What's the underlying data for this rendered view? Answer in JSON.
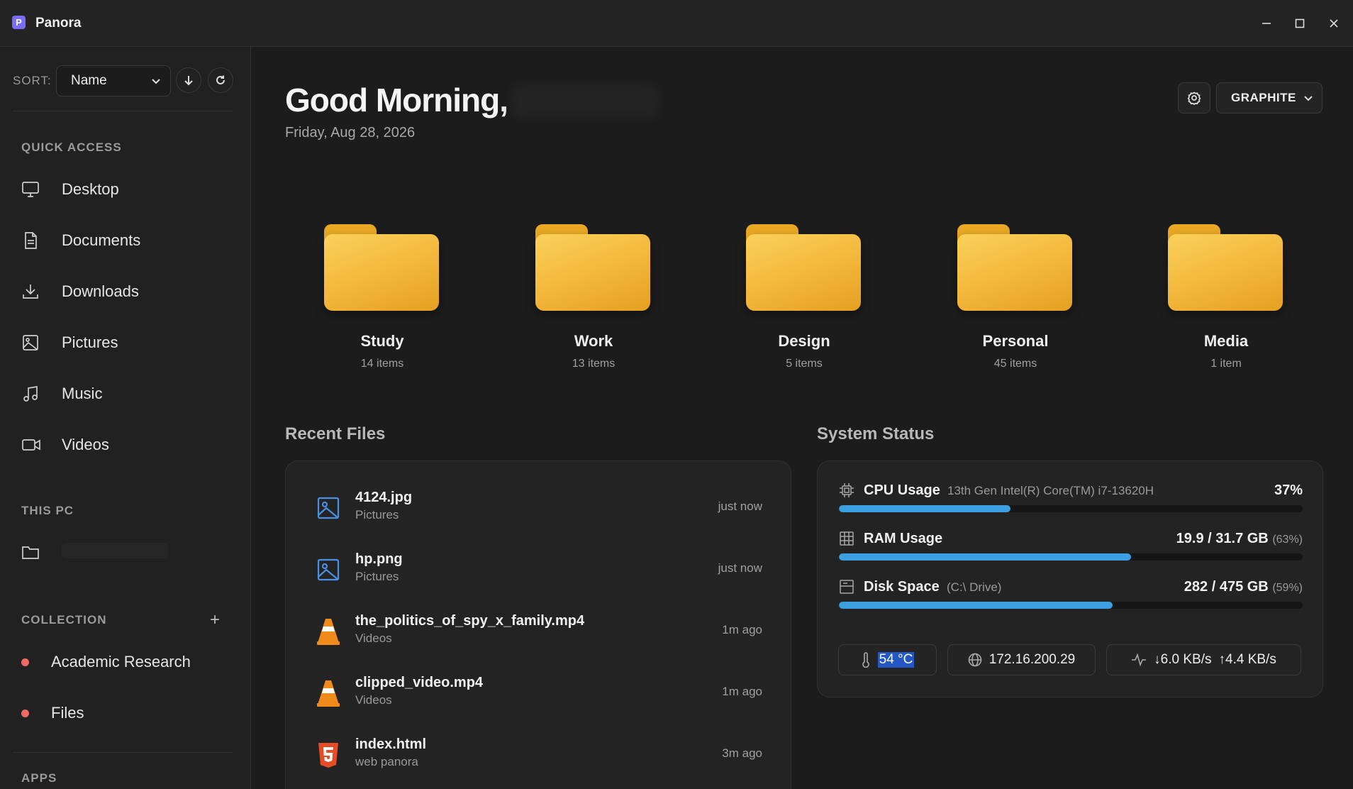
{
  "app": {
    "title": "Panora",
    "logo_letter": "P"
  },
  "sidebar": {
    "sort_label": "SORT:",
    "sort_value": "Name",
    "quick_access_title": "QUICK ACCESS",
    "quick_access": [
      {
        "label": "Desktop",
        "icon": "monitor-icon"
      },
      {
        "label": "Documents",
        "icon": "document-icon"
      },
      {
        "label": "Downloads",
        "icon": "download-icon"
      },
      {
        "label": "Pictures",
        "icon": "image-icon"
      },
      {
        "label": "Music",
        "icon": "music-icon"
      },
      {
        "label": "Videos",
        "icon": "video-icon"
      }
    ],
    "this_pc_title": "THIS PC",
    "collection_title": "COLLECTION",
    "collection_add": "+",
    "collections": [
      {
        "label": "Academic Research",
        "color": "#f16a6a"
      },
      {
        "label": "Files",
        "color": "#f16a6a"
      }
    ],
    "apps_title": "APPS"
  },
  "header": {
    "greeting": "Good Morning,",
    "date": "Friday, Aug 28, 2026",
    "theme": "GRAPHITE"
  },
  "folders": [
    {
      "name": "Study",
      "count": "14 items"
    },
    {
      "name": "Work",
      "count": "13 items"
    },
    {
      "name": "Design",
      "count": "5 items"
    },
    {
      "name": "Personal",
      "count": "45 items"
    },
    {
      "name": "Media",
      "count": "1 item"
    }
  ],
  "recent": {
    "title": "Recent Files",
    "files": [
      {
        "name": "4124.jpg",
        "location": "Pictures",
        "time": "just now",
        "icon": "image-file-icon"
      },
      {
        "name": "hp.png",
        "location": "Pictures",
        "time": "just now",
        "icon": "image-file-icon"
      },
      {
        "name": "the_politics_of_spy_x_family.mp4",
        "location": "Videos",
        "time": "1m ago",
        "icon": "vlc-cone-icon"
      },
      {
        "name": "clipped_video.mp4",
        "location": "Videos",
        "time": "1m ago",
        "icon": "vlc-cone-icon"
      },
      {
        "name": "index.html",
        "location": "web panora",
        "time": "3m ago",
        "icon": "html5-icon"
      }
    ]
  },
  "status": {
    "title": "System Status",
    "cpu": {
      "label": "CPU Usage",
      "detail": "13th Gen Intel(R) Core(TM) i7-13620H",
      "value": "37%",
      "fraction": 0.37
    },
    "ram": {
      "label": "RAM Usage",
      "value": "19.9 / 31.7 GB",
      "percent": "(63%)",
      "fraction": 0.63
    },
    "disk": {
      "label": "Disk Space",
      "detail": "(C:\\ Drive)",
      "value": "282 / 475 GB",
      "percent": "(59%)",
      "fraction": 0.59
    },
    "temperature": "54 °C",
    "ip": "172.16.200.29",
    "download": "6.0 KB/s",
    "upload": "4.4 KB/s",
    "accent": "#3c9fe0"
  }
}
